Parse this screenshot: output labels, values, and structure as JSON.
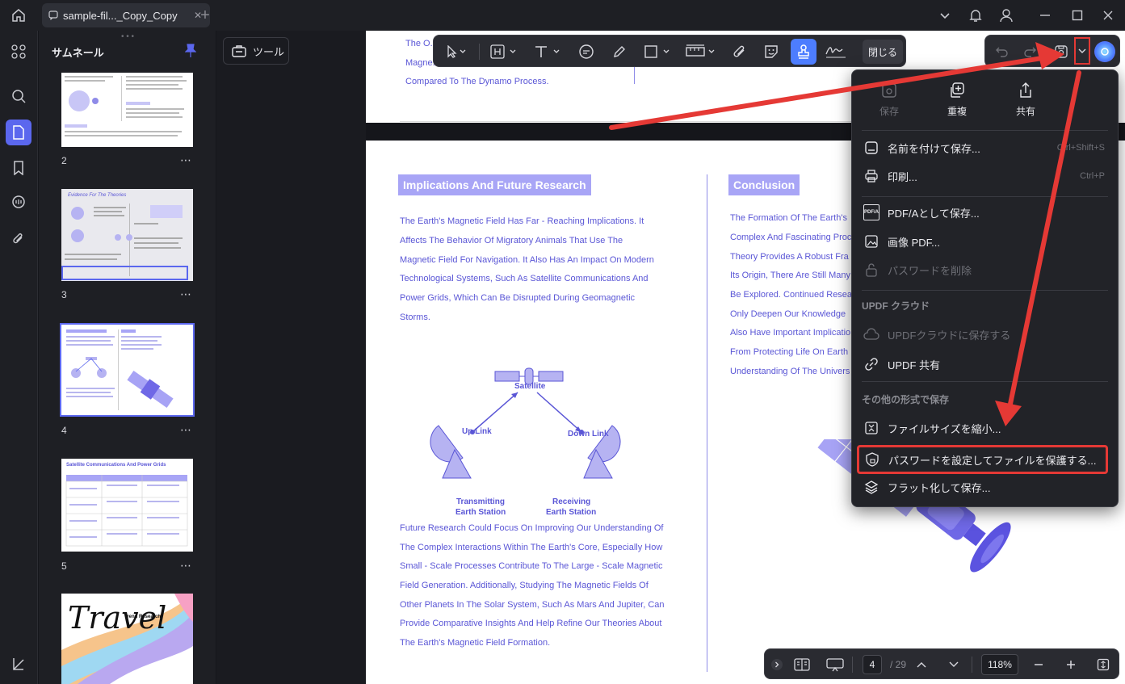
{
  "titlebar": {
    "tab_title": "sample-fil..._Copy_Copy"
  },
  "thumbnails": {
    "title": "サムネール",
    "pages": [
      {
        "num": "2",
        "more": "⋯"
      },
      {
        "num": "3",
        "more": "⋯",
        "heading": "Evidence For The Theories"
      },
      {
        "num": "4",
        "more": "⋯"
      },
      {
        "num": "5",
        "more": "⋯",
        "heading": "Satellite Communications And Power Grids"
      },
      {
        "heading": "Travel",
        "subheading": "Trend Research"
      }
    ]
  },
  "tools_button": {
    "label": "ツール"
  },
  "toolbar": {
    "close_label": "閉じる"
  },
  "document": {
    "prev_page_text": [
      "The O...",
      "Magne...",
      "Compared To The Dynamo Process."
    ],
    "left_heading": "Implications And Future Research",
    "left_para1": [
      "The Earth's Magnetic Field Has Far - Reaching Implications. It",
      "Affects The Behavior Of Migratory Animals That Use The",
      "Magnetic Field For Navigation. It Also Has An Impact On Modern",
      "Technological Systems, Such As Satellite Communications And",
      "Power Grids, Which Can Be Disrupted During Geomagnetic",
      "Storms."
    ],
    "diagram": {
      "satellite": "Satellite",
      "uplink": "Up Link",
      "downlink": "Down Link",
      "tx1": "Transmitting",
      "tx2": "Earth Station",
      "rx1": "Receiving",
      "rx2": "Earth Station"
    },
    "left_para2": [
      "Future Research Could Focus On Improving Our Understanding Of",
      "The Complex Interactions Within The Earth's Core, Especially How",
      "Small - Scale Processes Contribute To The Large - Scale Magnetic",
      "Field Generation. Additionally, Studying The Magnetic Fields Of",
      "Other Planets In The Solar System, Such As Mars And Jupiter, Can",
      "Provide Comparative Insights And Help Refine Our Theories About",
      "The Earth's Magnetic Field Formation."
    ],
    "right_heading": "Conclusion",
    "right_para": [
      "The Formation Of The Earth's",
      "Complex And Fascinating Proc",
      "Theory Provides A Robust Fra",
      "Its Origin, There Are Still Many",
      "Be Explored. Continued Resea",
      "Only Deepen Our Knowledge",
      "Also Have Important Implicatio",
      "From Protecting Life On Earth",
      "Understanding Of The Univers"
    ]
  },
  "menu": {
    "top": [
      {
        "label": "保存",
        "disabled": true
      },
      {
        "label": "重複"
      },
      {
        "label": "共有"
      }
    ],
    "save_as": {
      "label": "名前を付けて保存...",
      "shortcut": "Ctrl+Shift+S"
    },
    "print": {
      "label": "印刷...",
      "shortcut": "Ctrl+P"
    },
    "pdfa": {
      "label": "PDF/Aとして保存...",
      "icon_text": "PDF/A"
    },
    "image_pdf": {
      "label": "画像 PDF..."
    },
    "remove_password": {
      "label": "パスワードを削除"
    },
    "cloud_section": "UPDF クラウド",
    "save_cloud": {
      "label": "UPDFクラウドに保存する"
    },
    "updf_share": {
      "label": "UPDF 共有"
    },
    "other_section": "その他の形式で保存",
    "reduce_size": {
      "label": "ファイルサイズを縮小..."
    },
    "protect": {
      "label": "パスワードを設定してファイルを保護する..."
    },
    "flatten": {
      "label": "フラット化して保存..."
    }
  },
  "bottombar": {
    "current_page": "4",
    "total_pages": "/ 29",
    "zoom": "118%"
  },
  "colors": {
    "accent": "#5b67ee",
    "highlight": "#e53935",
    "doc_purple": "#5a56d6"
  }
}
